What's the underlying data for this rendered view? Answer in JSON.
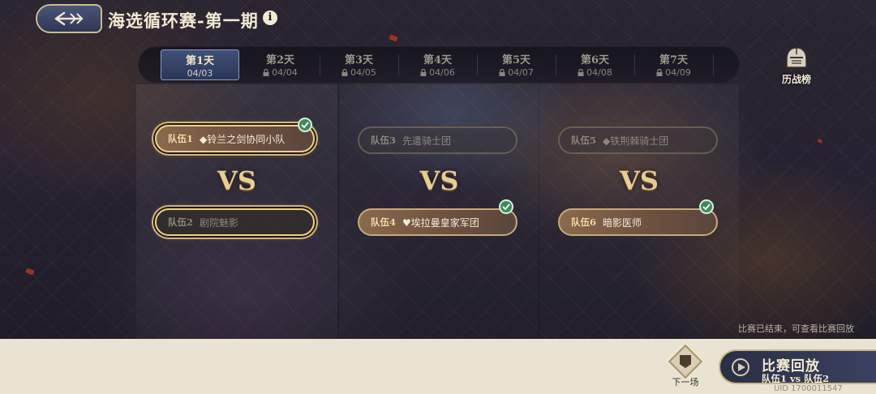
{
  "header": {
    "title": "海选循环赛-第一期",
    "info_icon": "i"
  },
  "tabs": [
    {
      "day": "第1天",
      "date": "04/03",
      "locked": false,
      "active": true
    },
    {
      "day": "第2天",
      "date": "04/04",
      "locked": true,
      "active": false
    },
    {
      "day": "第3天",
      "date": "04/05",
      "locked": true,
      "active": false
    },
    {
      "day": "第4天",
      "date": "04/06",
      "locked": true,
      "active": false
    },
    {
      "day": "第5天",
      "date": "04/07",
      "locked": true,
      "active": false
    },
    {
      "day": "第6天",
      "date": "04/08",
      "locked": true,
      "active": false
    },
    {
      "day": "第7天",
      "date": "04/09",
      "locked": true,
      "active": false
    }
  ],
  "history": {
    "label": "历战榜"
  },
  "matches": [
    {
      "vs": "VS",
      "top": {
        "num": "队伍1",
        "name": "◆铃兰之剑协同小队",
        "winner": true,
        "selected": true
      },
      "bottom": {
        "num": "队伍2",
        "name": "剧院魅影",
        "winner": false,
        "selected": true
      }
    },
    {
      "vs": "VS",
      "top": {
        "num": "队伍3",
        "name": "先遣骑士团",
        "winner": false,
        "selected": false
      },
      "bottom": {
        "num": "队伍4",
        "name": "♥埃拉曼皇家军团",
        "winner": true,
        "selected": false
      }
    },
    {
      "vs": "VS",
      "top": {
        "num": "队伍5",
        "name": "◆铁荆棘骑士团",
        "winner": false,
        "selected": false
      },
      "bottom": {
        "num": "队伍6",
        "name": "暗影医师",
        "winner": true,
        "selected": false
      }
    }
  ],
  "status_note": "比赛已结束，可查看比赛回放",
  "next_match": {
    "label": "下一场"
  },
  "replay": {
    "title": "比赛回放",
    "subtitle": "队伍1 vs 队伍2"
  },
  "uid": "UID 1700011547",
  "colors": {
    "winner_check": "#3f8a5c",
    "accent_gold": "#d6b46e",
    "tab_active": "#40507a"
  }
}
